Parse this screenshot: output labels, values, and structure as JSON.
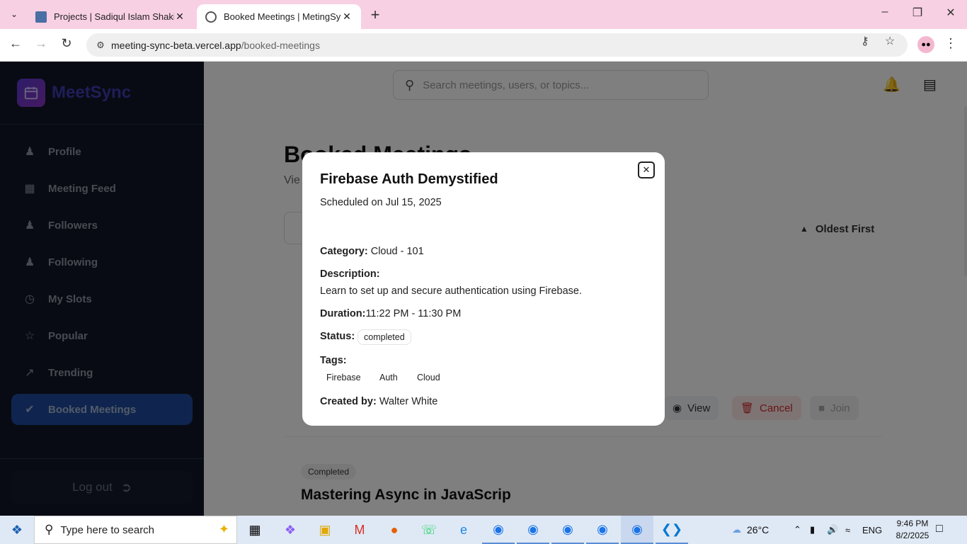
{
  "browser": {
    "tabs": [
      {
        "title": "Projects | Sadiqul Islam Shakib",
        "active": false
      },
      {
        "title": "Booked Meetings | MetingSync",
        "active": true
      }
    ],
    "url_host": "meeting-sync-beta.vercel.app",
    "url_path": "/booked-meetings"
  },
  "sidebar": {
    "brand": "MeetSync",
    "items": [
      {
        "label": "Profile",
        "icon": "user-icon"
      },
      {
        "label": "Meeting Feed",
        "icon": "calendar-icon"
      },
      {
        "label": "Followers",
        "icon": "users-icon"
      },
      {
        "label": "Following",
        "icon": "users-group-icon"
      },
      {
        "label": "My Slots",
        "icon": "clock-icon"
      },
      {
        "label": "Popular",
        "icon": "star-icon"
      },
      {
        "label": "Trending",
        "icon": "trending-icon"
      },
      {
        "label": "Booked Meetings",
        "icon": "check-circle-icon",
        "active": true
      }
    ],
    "logout_label": "Log out"
  },
  "header": {
    "search_placeholder": "Search meetings, users, or topics..."
  },
  "page": {
    "title": "Booked Meetings",
    "subtitle": "Vie",
    "sort_label": "Oldest First",
    "card_actions": {
      "view": "View",
      "cancel": "Cancel",
      "join": "Join"
    },
    "card2": {
      "status": "Completed",
      "title": "Mastering Async in JavaScrip"
    }
  },
  "modal": {
    "title": "Firebase Auth Demystified",
    "scheduled": "Scheduled on Jul 15, 2025",
    "category_label": "Category:",
    "category_value": "Cloud - 101",
    "description_label": "Description:",
    "description_value": "Learn to set up and secure authentication using Firebase.",
    "duration_label": "Duration:",
    "duration_value": "11:22 PM - 11:30 PM",
    "status_label": "Status:",
    "status_value": "completed",
    "tags_label": "Tags:",
    "tags": [
      "Firebase",
      "Auth",
      "Cloud"
    ],
    "created_by_label": "Created by:",
    "created_by_value": "Walter White"
  },
  "taskbar": {
    "search_placeholder": "Type here to search",
    "weather": "26°C",
    "language": "ENG",
    "time": "9:46 PM",
    "date": "8/2/2025"
  }
}
